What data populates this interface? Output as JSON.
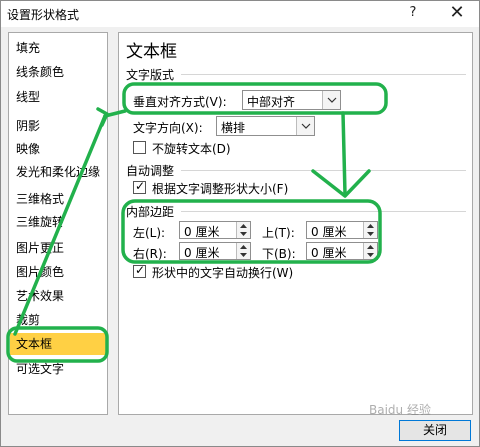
{
  "window": {
    "title": "设置形状格式",
    "help_glyph": "?",
    "close_glyph": "✕"
  },
  "sidebar": {
    "items": [
      {
        "label": "填充"
      },
      {
        "label": "线条颜色"
      },
      {
        "label": "线型"
      },
      {
        "label": "阴影"
      },
      {
        "label": "映像"
      },
      {
        "label": "发光和柔化边缘"
      },
      {
        "label": "三维格式"
      },
      {
        "label": "三维旋转"
      },
      {
        "label": "图片更正"
      },
      {
        "label": "图片颜色"
      },
      {
        "label": "艺术效果"
      },
      {
        "label": "裁剪"
      },
      {
        "label": "文本框"
      },
      {
        "label": "可选文字"
      }
    ],
    "active_index": 12
  },
  "panel": {
    "title": "文本框",
    "text_layout": {
      "heading": "文字版式",
      "vertical_align_label": "垂直对齐方式(V):",
      "vertical_align_value": "中部对齐",
      "text_direction_label": "文字方向(X):",
      "text_direction_value": "横排",
      "no_rotate_label": "不旋转文本(D)",
      "no_rotate_checked": false
    },
    "autofit": {
      "heading": "自动调整",
      "resize_label": "根据文字调整形状大小(F)",
      "resize_checked": true
    },
    "margins": {
      "heading": "内部边距",
      "left_label": "左(L):",
      "left_value": "0 厘米",
      "top_label": "上(T):",
      "top_value": "0 厘米",
      "right_label": "右(R):",
      "right_value": "0 厘米",
      "bottom_label": "下(B):",
      "bottom_value": "0 厘米",
      "wrap_label": "形状中的文字自动换行(W)",
      "wrap_checked": true
    }
  },
  "footer": {
    "close_label": "关闭"
  },
  "watermark": "Baidu 经验",
  "annotation_color": "#22b14c",
  "icons": {
    "dropdown": "chevron-down-icon",
    "spin_up": "triangle-up-icon",
    "spin_down": "triangle-down-icon",
    "check": "checkmark-icon"
  }
}
